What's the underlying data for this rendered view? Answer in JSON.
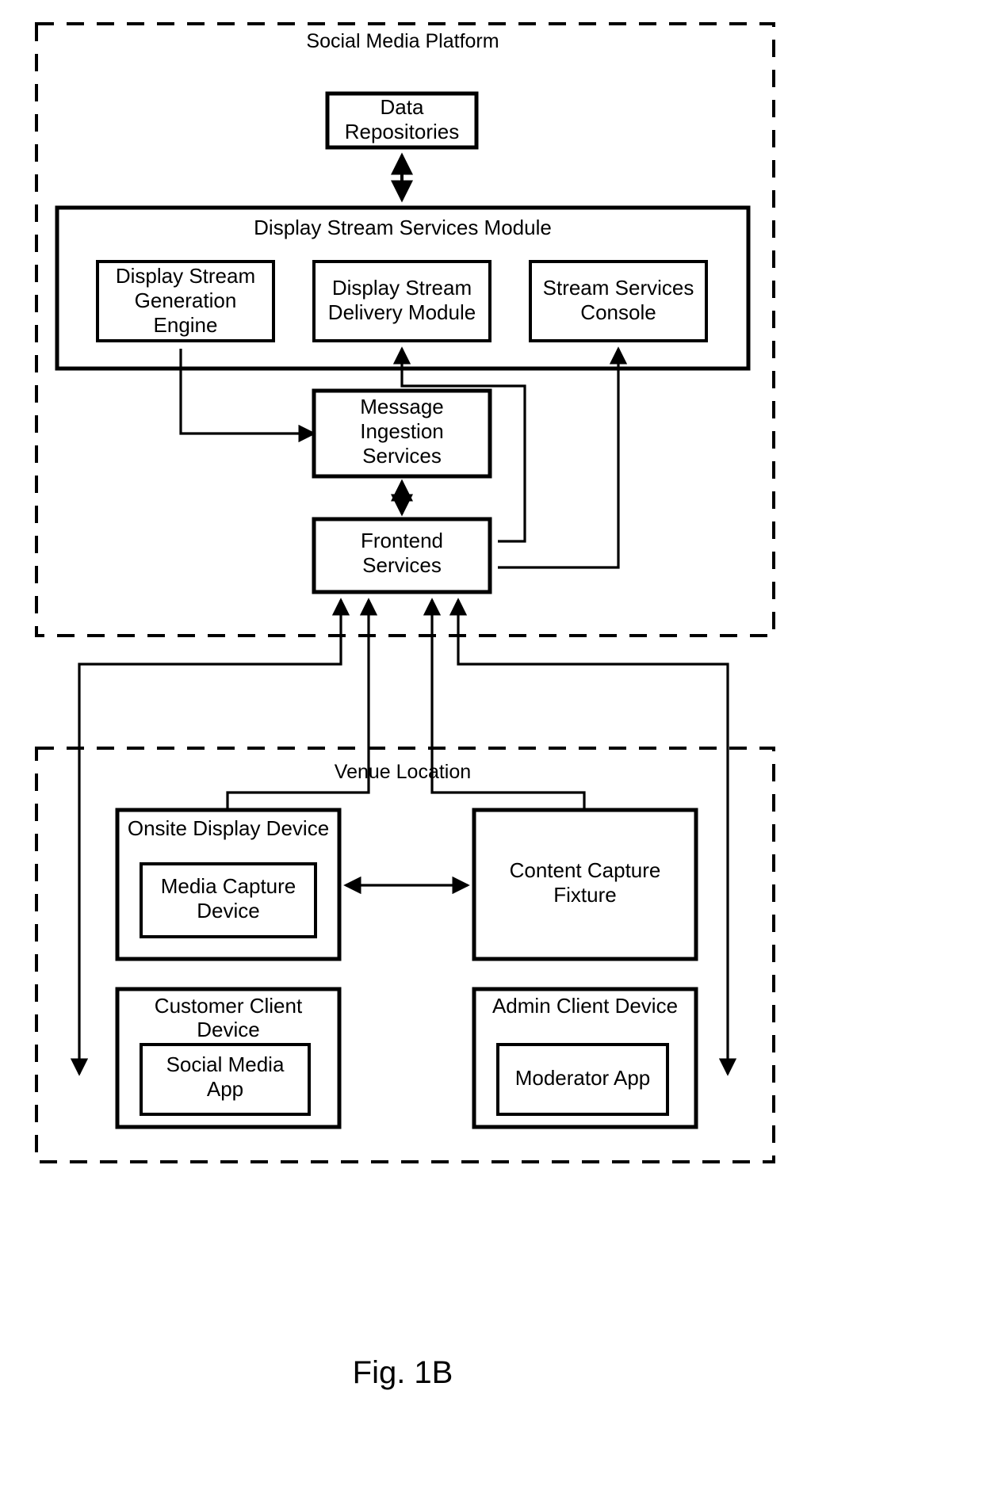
{
  "figure": {
    "caption": "Fig. 1B"
  },
  "regions": [
    {
      "id": "social-media-platform",
      "label": "Social Media Platform"
    },
    {
      "id": "venue-location",
      "label": "Venue Location"
    }
  ],
  "platform": {
    "title": "Social Media Platform",
    "data_repositories": {
      "line1": "Data",
      "line2": "Repositories"
    },
    "display_stream_services_module": {
      "title": "Display Stream Services Module",
      "children": [
        {
          "id": "display-stream-generation-engine",
          "line1": "Display Stream",
          "line2": "Generation",
          "line3": "Engine"
        },
        {
          "id": "display-stream-delivery-module",
          "line1": "Display Stream",
          "line2": "Delivery Module",
          "line3": ""
        },
        {
          "id": "stream-services-console",
          "line1": "Stream Services",
          "line2": "Console",
          "line3": ""
        }
      ]
    },
    "message_ingestion_services": {
      "line1": "Message",
      "line2": "Ingestion",
      "line3": "Services"
    },
    "frontend_services": {
      "line1": "Frontend",
      "line2": "Services"
    }
  },
  "venue": {
    "title": "Venue Location",
    "onsite_display_device": {
      "label": "Onsite Display Device",
      "inner": {
        "line1": "Media Capture",
        "line2": "Device"
      }
    },
    "content_capture_fixture": {
      "line1": "Content Capture",
      "line2": "Fixture"
    },
    "customer_client_device": {
      "line1": "Customer Client",
      "line2": "Device",
      "inner": {
        "line1": "Social Media",
        "line2": "App"
      }
    },
    "admin_client_device": {
      "label": "Admin Client Device",
      "inner": {
        "line1": "Moderator App",
        "line2": ""
      }
    }
  },
  "colors": {
    "stroke": "#000000",
    "fill": "#ffffff"
  }
}
